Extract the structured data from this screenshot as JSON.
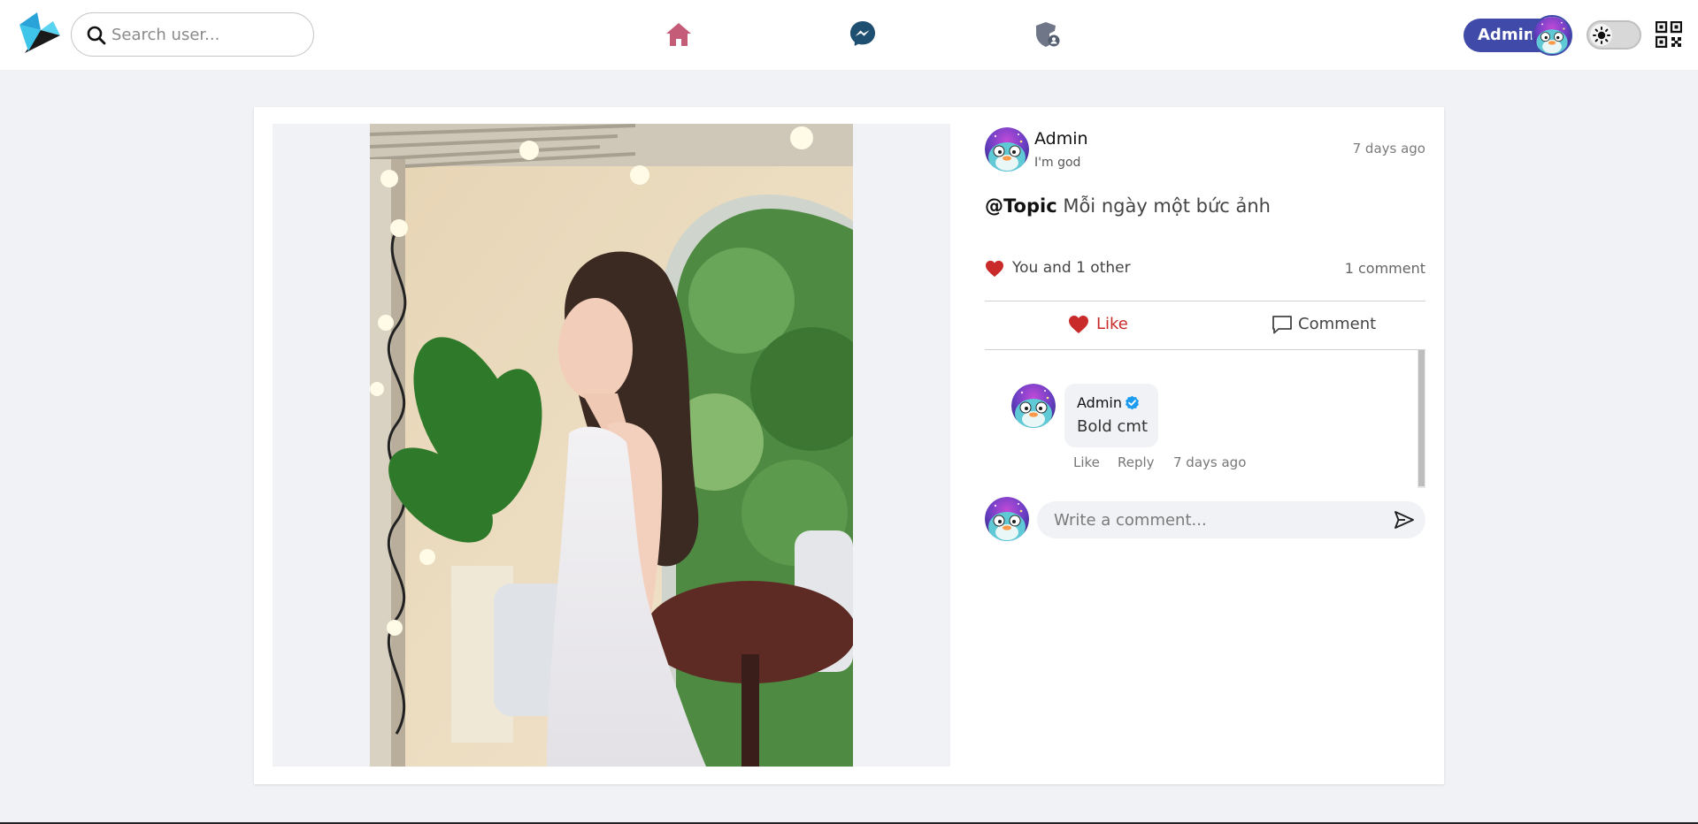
{
  "navbar": {
    "search": {
      "placeholder": "Search user...",
      "value": ""
    },
    "user_pill": {
      "name": "Admin"
    },
    "icons": [
      "logo",
      "search-icon",
      "home-icon",
      "messenger-icon",
      "admin-shield-icon",
      "sun-icon",
      "qr-code-icon"
    ]
  },
  "post": {
    "author": {
      "name": "Admin",
      "status": "I'm god"
    },
    "time": "7 days ago",
    "topic_tag": "@Topic",
    "caption": "Mỗi ngày một bức ảnh",
    "likes_text": "You and 1 other",
    "comments_count": "1 comment",
    "actions": {
      "like": "Like",
      "comment": "Comment"
    },
    "comments": [
      {
        "author": "Admin",
        "verified": true,
        "text": "Bold cmt",
        "like": "Like",
        "reply": "Reply",
        "time": "7 days ago"
      }
    ],
    "composer": {
      "placeholder": "Write a comment..."
    }
  },
  "colors": {
    "brand": "#3f4aa9",
    "like_red": "#c92a2a",
    "home_icon": "#c45c78",
    "messenger_icon": "#1f4f70",
    "verified_blue": "#1d9bf0",
    "page_bg": "#f0f2f5"
  }
}
